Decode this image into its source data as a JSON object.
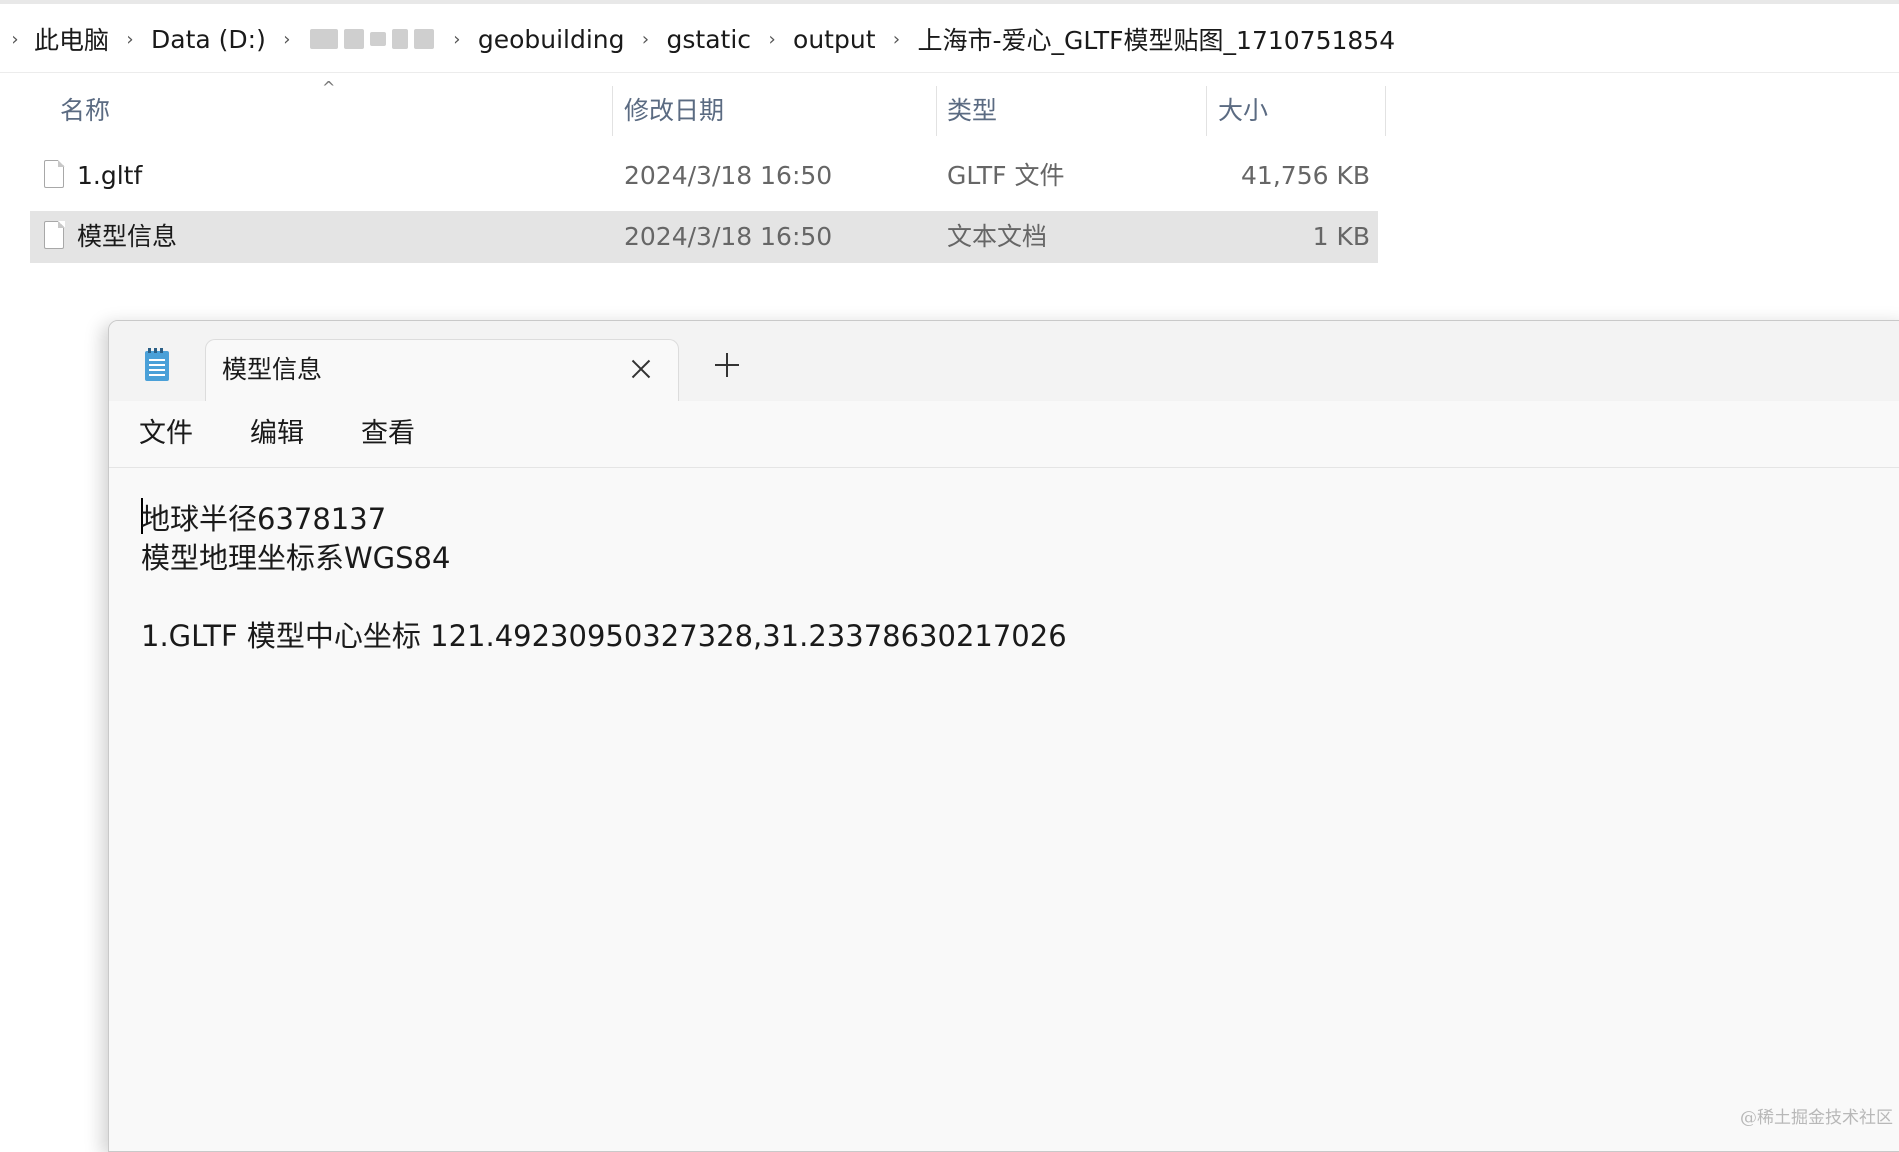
{
  "breadcrumb": {
    "items": [
      {
        "label": "此电脑"
      },
      {
        "label": "Data (D:)"
      },
      {
        "label": "",
        "blurred": true
      },
      {
        "label": "geobuilding"
      },
      {
        "label": "gstatic"
      },
      {
        "label": "output"
      },
      {
        "label": "上海市-爱心_GLTF模型贴图_1710751854"
      }
    ]
  },
  "file_list": {
    "columns": {
      "name": "名称",
      "modified": "修改日期",
      "type": "类型",
      "size": "大小"
    },
    "sort_indicator": "^",
    "rows": [
      {
        "name": "1.gltf",
        "modified": "2024/3/18 16:50",
        "type": "GLTF 文件",
        "size": "41,756 KB",
        "selected": false
      },
      {
        "name": "模型信息",
        "modified": "2024/3/18 16:50",
        "type": "文本文档",
        "size": "1 KB",
        "selected": true
      }
    ]
  },
  "notepad": {
    "app_icon": "notepad-icon",
    "tab_title": "模型信息",
    "menu": {
      "file": "文件",
      "edit": "编辑",
      "view": "查看"
    },
    "content_lines": [
      "地球半径6378137",
      "模型地理坐标系WGS84",
      "",
      "1.GLTF 模型中心坐标 121.49230950327328,31.23378630217026"
    ]
  },
  "watermark": "@稀土掘金技术社区"
}
